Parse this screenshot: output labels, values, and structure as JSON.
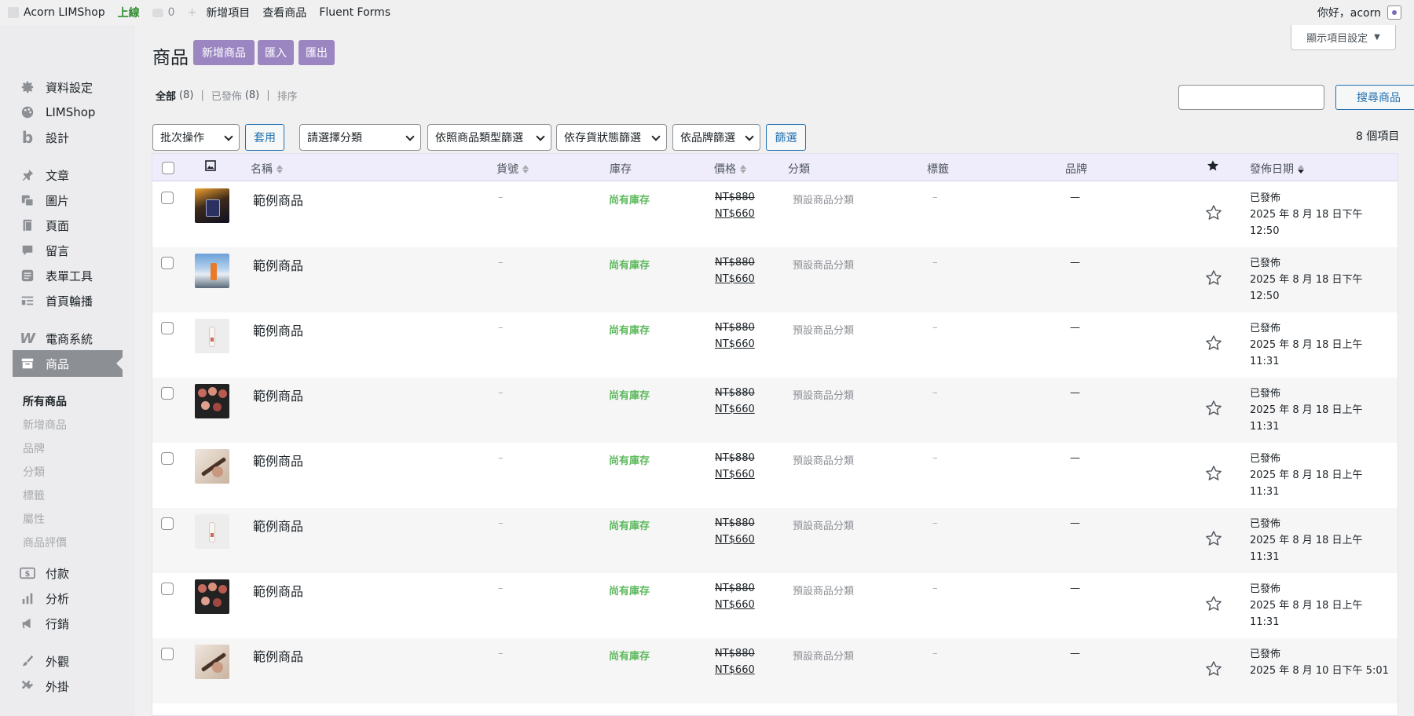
{
  "adminbar": {
    "site_name": "Acorn LIMShop",
    "live": "上線",
    "comments": "0",
    "new_item": "新增項目",
    "view_products": "查看商品",
    "fluent_forms": "Fluent Forms",
    "greeting": "你好，acorn"
  },
  "sidebar": {
    "items": [
      {
        "label": "資料設定",
        "icon": "gear-icon"
      },
      {
        "label": "LIMShop",
        "icon": "palette-icon"
      },
      {
        "label": "設計",
        "icon": "b-logo-icon"
      },
      {
        "label": "文章",
        "icon": "pin-icon"
      },
      {
        "label": "圖片",
        "icon": "media-icon"
      },
      {
        "label": "頁面",
        "icon": "page-icon"
      },
      {
        "label": "留言",
        "icon": "comment-icon"
      },
      {
        "label": "表單工具",
        "icon": "form-icon"
      },
      {
        "label": "首頁輪播",
        "icon": "slider-icon"
      },
      {
        "label": "電商系統",
        "icon": "woo-icon"
      },
      {
        "label": "商品",
        "icon": "archive-icon"
      },
      {
        "label": "付款",
        "icon": "dollar-icon"
      },
      {
        "label": "分析",
        "icon": "chart-icon"
      },
      {
        "label": "行銷",
        "icon": "megaphone-icon"
      },
      {
        "label": "外觀",
        "icon": "brush-icon"
      },
      {
        "label": "外掛",
        "icon": "plugin-icon"
      }
    ],
    "submenu": [
      "所有商品",
      "新增商品",
      "品牌",
      "分類",
      "標籤",
      "屬性",
      "商品評價"
    ]
  },
  "header": {
    "screen_options": "顯示項目設定",
    "title": "商品",
    "add_new": "新增商品",
    "import": "匯入",
    "export": "匯出"
  },
  "views": {
    "all": "全部",
    "all_count": "(8)",
    "published": "已發佈",
    "published_count": "(8)",
    "sort": "排序"
  },
  "search": {
    "button": "搜尋商品",
    "value": ""
  },
  "filters": {
    "bulk": "批次操作",
    "apply": "套用",
    "category": "請選擇分類",
    "type": "依照商品類型篩選",
    "stock": "依存貨狀態篩選",
    "brand": "依品牌篩選",
    "filter": "篩選",
    "item_count": "8 個項目"
  },
  "columns": {
    "name": "名稱",
    "sku": "貨號",
    "stock": "庫存",
    "price": "價格",
    "category": "分類",
    "tags": "標籤",
    "brand": "品牌",
    "date": "發佈日期"
  },
  "products": [
    {
      "name": "範例商品",
      "sku": "–",
      "stock": "尚有庫存",
      "price_old": "NT$880",
      "price_new": "NT$660",
      "category": "預設商品分類",
      "tags": "–",
      "brand": "—",
      "status": "已發佈",
      "date": "2025 年 8 月 18 日下午",
      "time": "12:50",
      "thumb": "perfume"
    },
    {
      "name": "範例商品",
      "sku": "–",
      "stock": "尚有庫存",
      "price_old": "NT$880",
      "price_new": "NT$660",
      "category": "預設商品分類",
      "tags": "–",
      "brand": "—",
      "status": "已發佈",
      "date": "2025 年 8 月 18 日下午",
      "time": "12:50",
      "thumb": "mountain"
    },
    {
      "name": "範例商品",
      "sku": "–",
      "stock": "尚有庫存",
      "price_old": "NT$880",
      "price_new": "NT$660",
      "category": "預設商品分類",
      "tags": "–",
      "brand": "—",
      "status": "已發佈",
      "date": "2025 年 8 月 18 日上午",
      "time": "11:31",
      "thumb": "bottle"
    },
    {
      "name": "範例商品",
      "sku": "–",
      "stock": "尚有庫存",
      "price_old": "NT$880",
      "price_new": "NT$660",
      "category": "預設商品分類",
      "tags": "–",
      "brand": "—",
      "status": "已發佈",
      "date": "2025 年 8 月 18 日上午",
      "time": "11:31",
      "thumb": "palette"
    },
    {
      "name": "範例商品",
      "sku": "–",
      "stock": "尚有庫存",
      "price_old": "NT$880",
      "price_new": "NT$660",
      "category": "預設商品分類",
      "tags": "–",
      "brand": "—",
      "status": "已發佈",
      "date": "2025 年 8 月 18 日上午",
      "time": "11:31",
      "thumb": "brush"
    },
    {
      "name": "範例商品",
      "sku": "–",
      "stock": "尚有庫存",
      "price_old": "NT$880",
      "price_new": "NT$660",
      "category": "預設商品分類",
      "tags": "–",
      "brand": "—",
      "status": "已發佈",
      "date": "2025 年 8 月 18 日上午",
      "time": "11:31",
      "thumb": "bottle"
    },
    {
      "name": "範例商品",
      "sku": "–",
      "stock": "尚有庫存",
      "price_old": "NT$880",
      "price_new": "NT$660",
      "category": "預設商品分類",
      "tags": "–",
      "brand": "—",
      "status": "已發佈",
      "date": "2025 年 8 月 18 日上午",
      "time": "11:31",
      "thumb": "palette"
    },
    {
      "name": "範例商品",
      "sku": "–",
      "stock": "尚有庫存",
      "price_old": "NT$880",
      "price_new": "NT$660",
      "category": "預設商品分類",
      "tags": "–",
      "brand": "—",
      "status": "已發佈",
      "date": "2025 年 8 月 10 日下午 5:01",
      "time": "",
      "thumb": "brush"
    }
  ],
  "colors": {
    "accent": "#9b86c2",
    "link": "#2271b1",
    "in_stock": "#5cb85c",
    "header_row": "#efecfb"
  }
}
